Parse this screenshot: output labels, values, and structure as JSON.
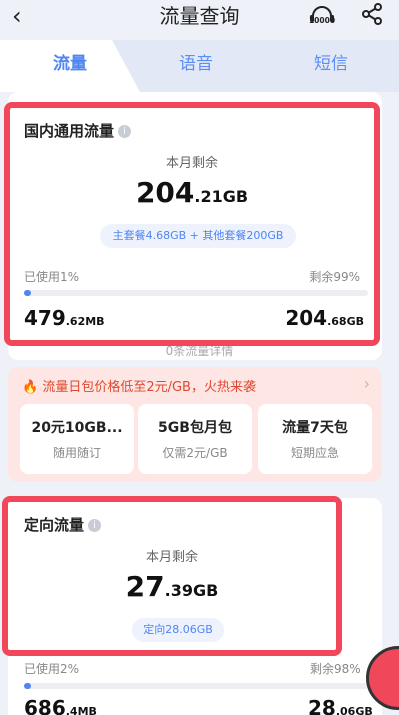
{
  "header": {
    "title": "流量查询",
    "back_icon": "‹",
    "service_icon_label": "10000"
  },
  "tabs": [
    {
      "label": "流量",
      "active": true
    },
    {
      "label": "语音",
      "active": false
    },
    {
      "label": "短信",
      "active": false
    }
  ],
  "domestic": {
    "title": "国内通用流量",
    "remain_label": "本月剩余",
    "remain_int": "204",
    "remain_dec": ".21GB",
    "breakdown": "主套餐4.68GB + 其他套餐200GB",
    "used_label": "已使用1%",
    "remain_pct_label": "剩余99%",
    "used_fraction": 0.01,
    "used_int": "479",
    "used_unit": ".62MB",
    "total_int": "204",
    "total_unit": ".68GB",
    "details_link": "0条流量详情"
  },
  "promo": {
    "banner": "流量日包价格低至2元/GB，火热来袭",
    "packages": [
      {
        "name": "20元10GB...",
        "desc": "随用随订"
      },
      {
        "name": "5GB包月包",
        "desc": "仅需2元/GB"
      },
      {
        "name": "流量7天包",
        "desc": "短期应急"
      }
    ]
  },
  "directed": {
    "title": "定向流量",
    "remain_label": "本月剩余",
    "remain_int": "27",
    "remain_dec": ".39GB",
    "breakdown": "定向28.06GB",
    "used_label": "已使用2%",
    "remain_pct_label": "剩余98%",
    "used_fraction": 0.02,
    "used_int": "686",
    "used_unit": ".4MB",
    "total_int": "28",
    "total_unit": ".06GB"
  },
  "colors": {
    "accent": "#4f86f2",
    "highlight_border": "#f0475a",
    "promo_bg": "#fde6e4"
  }
}
